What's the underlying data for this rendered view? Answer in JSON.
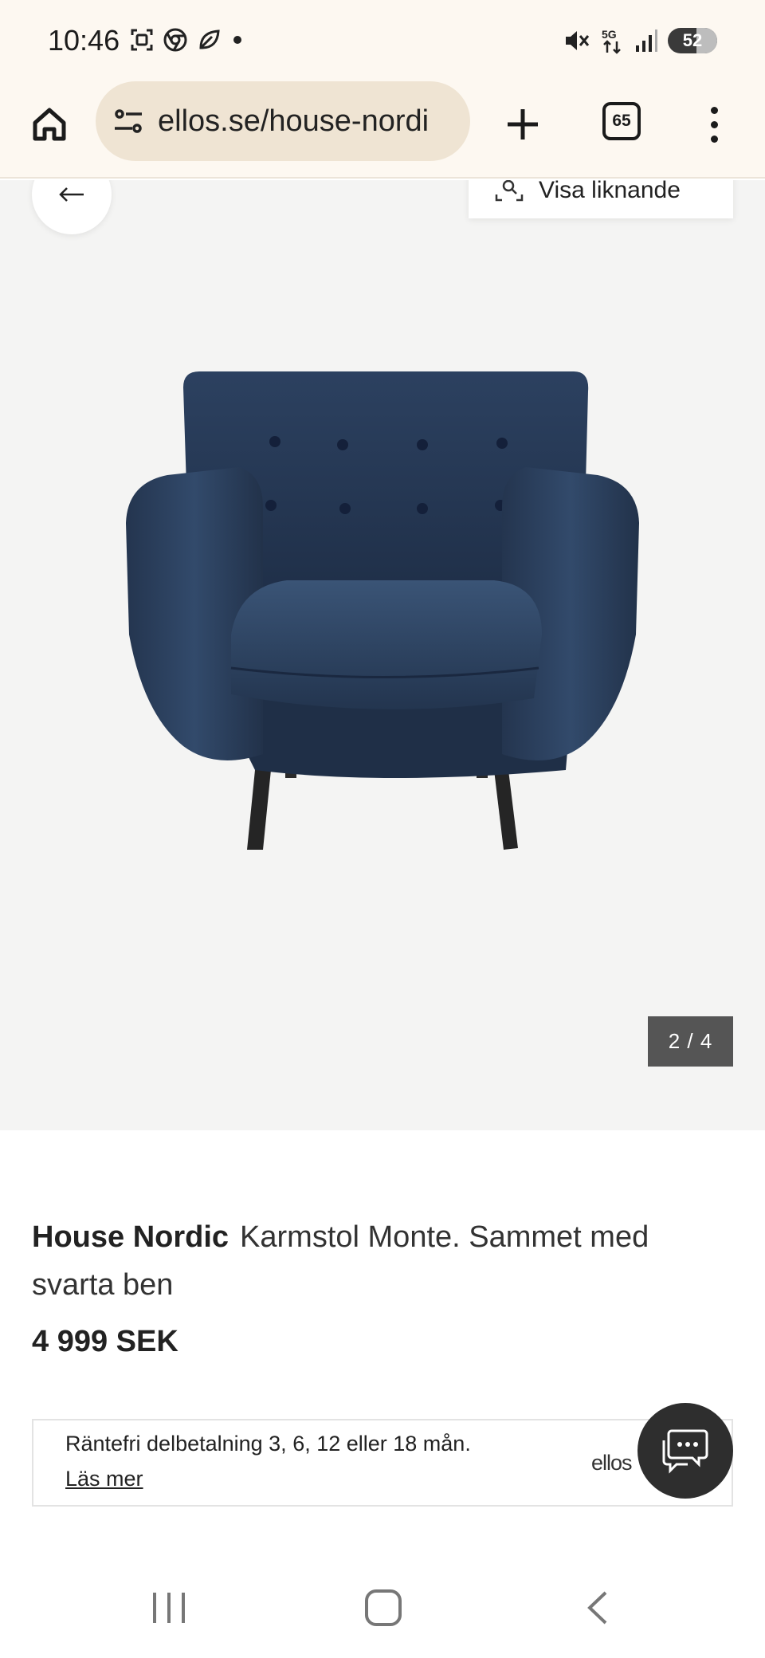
{
  "status_bar": {
    "time": "10:46",
    "left_icons": [
      "screenshot-icon",
      "chrome-icon",
      "leaf-icon",
      "dot-icon"
    ],
    "right_icons": [
      "mute-icon",
      "5g-icon",
      "signal-icon"
    ],
    "battery": "52"
  },
  "browser": {
    "url": "ellos.se/house-nordi",
    "tab_count": "65"
  },
  "gallery": {
    "similar_label": "Visa liknande",
    "counter": "2 / 4"
  },
  "product": {
    "brand": "House Nordic",
    "name": "Karmstol Monte. Sammet med svarta ben",
    "price": "4 999 SEK"
  },
  "finance": {
    "text": "Räntefri delbetalning 3, 6, 12 eller 18 mån.",
    "link": "Läs mer",
    "logo": "ellos"
  },
  "colors": {
    "chrome_bg": "#fdf8f1",
    "url_bg": "#efe4d3",
    "gallery_bg": "#f4f4f3",
    "chair_fabric": "#2b3e5a",
    "chat_button": "#2e2e2e"
  }
}
